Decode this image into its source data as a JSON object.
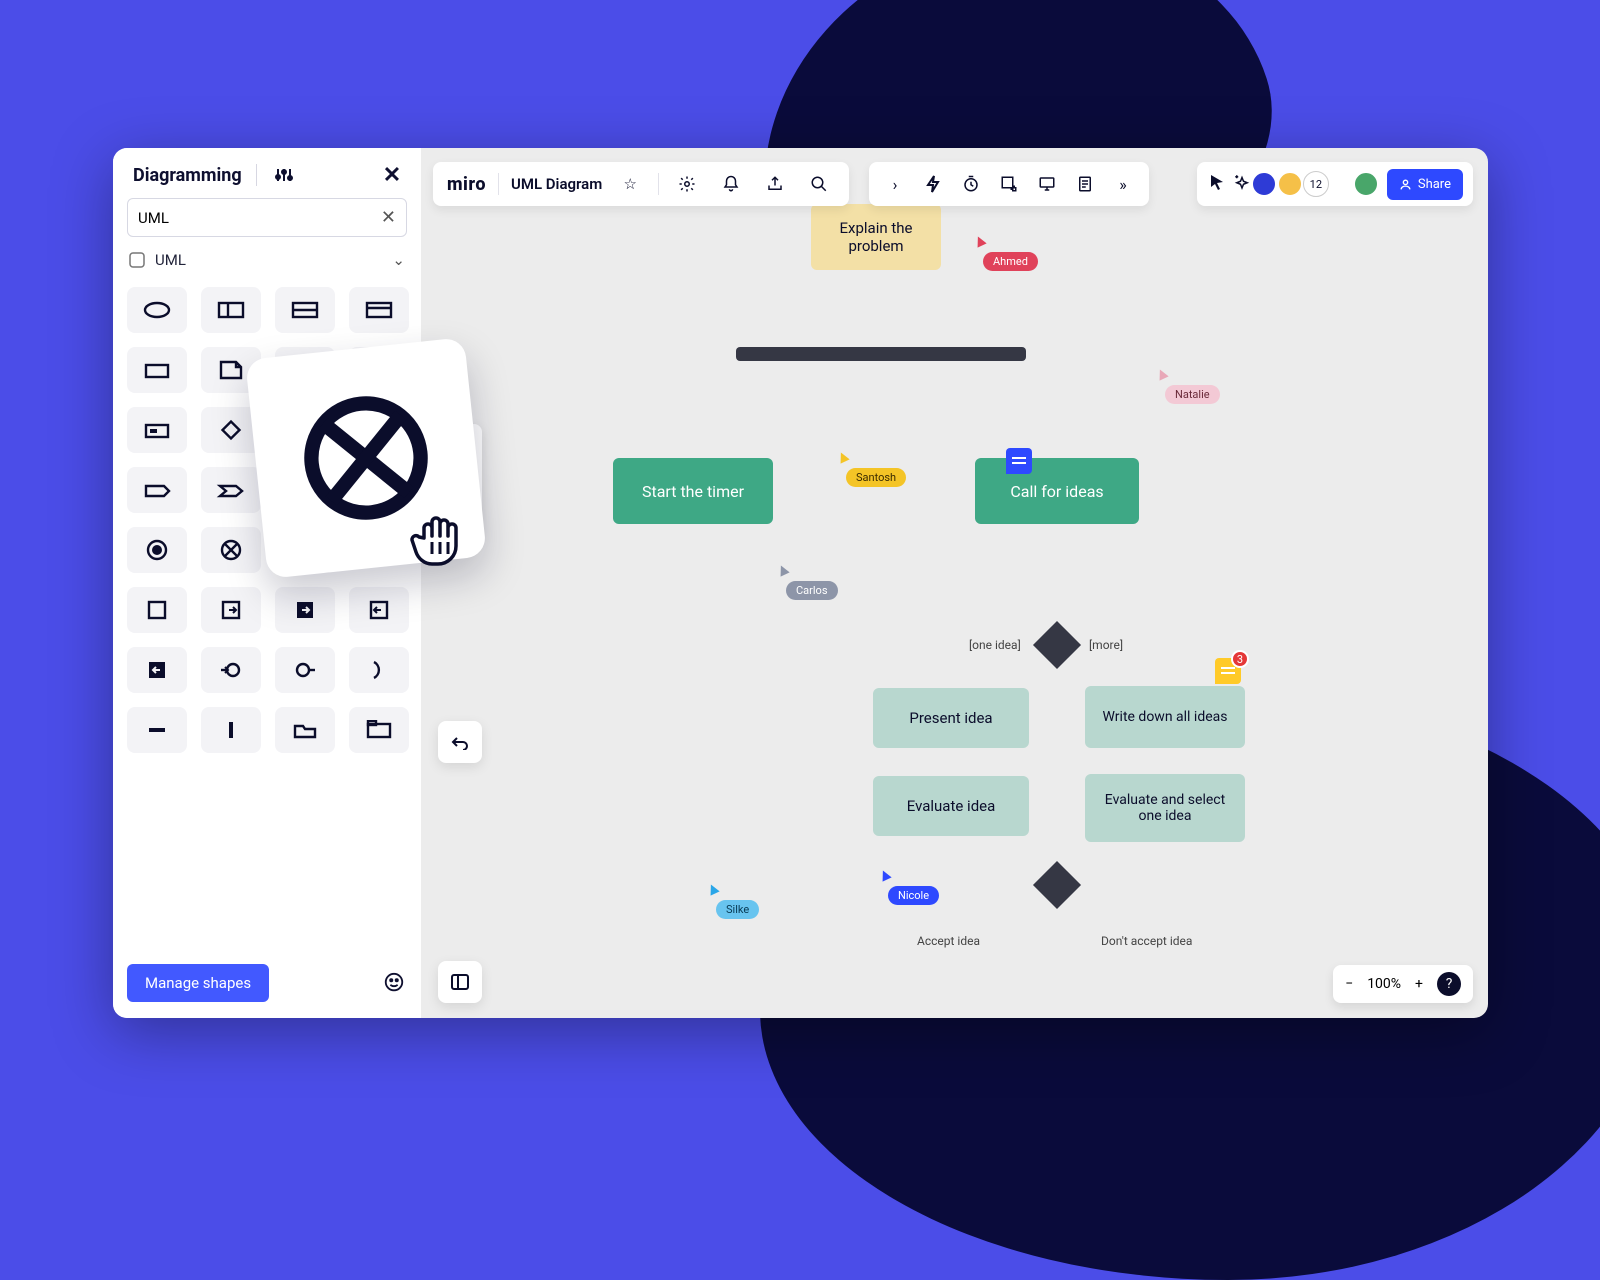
{
  "sidebar": {
    "title": "Diagramming",
    "search_value": "UML",
    "category_label": "UML",
    "manage_btn": "Manage shapes"
  },
  "document": {
    "app_logo": "miro",
    "name": "UML Diagram"
  },
  "presence": {
    "count": "12",
    "share_label": "Share"
  },
  "zoom": {
    "minus": "−",
    "pct": "100%",
    "plus": "+",
    "help": "?"
  },
  "flow": {
    "explain": "Explain the problem",
    "start_timer": "Start the timer",
    "call_ideas": "Call for ideas",
    "present": "Present idea",
    "writeall": "Write down all ideas",
    "eval": "Evaluate idea",
    "evalsel": "Evaluate and select one idea",
    "one_idea": "[one idea]",
    "more": "[more]",
    "accept": "Accept idea",
    "dont_accept": "Don't accept idea"
  },
  "cursors": {
    "ahmed": "Ahmed",
    "natalie": "Natalie",
    "santosh": "Santosh",
    "carlos": "Carlos",
    "nicole": "Nicole",
    "silke": "Silke"
  },
  "comment_badge": "3"
}
